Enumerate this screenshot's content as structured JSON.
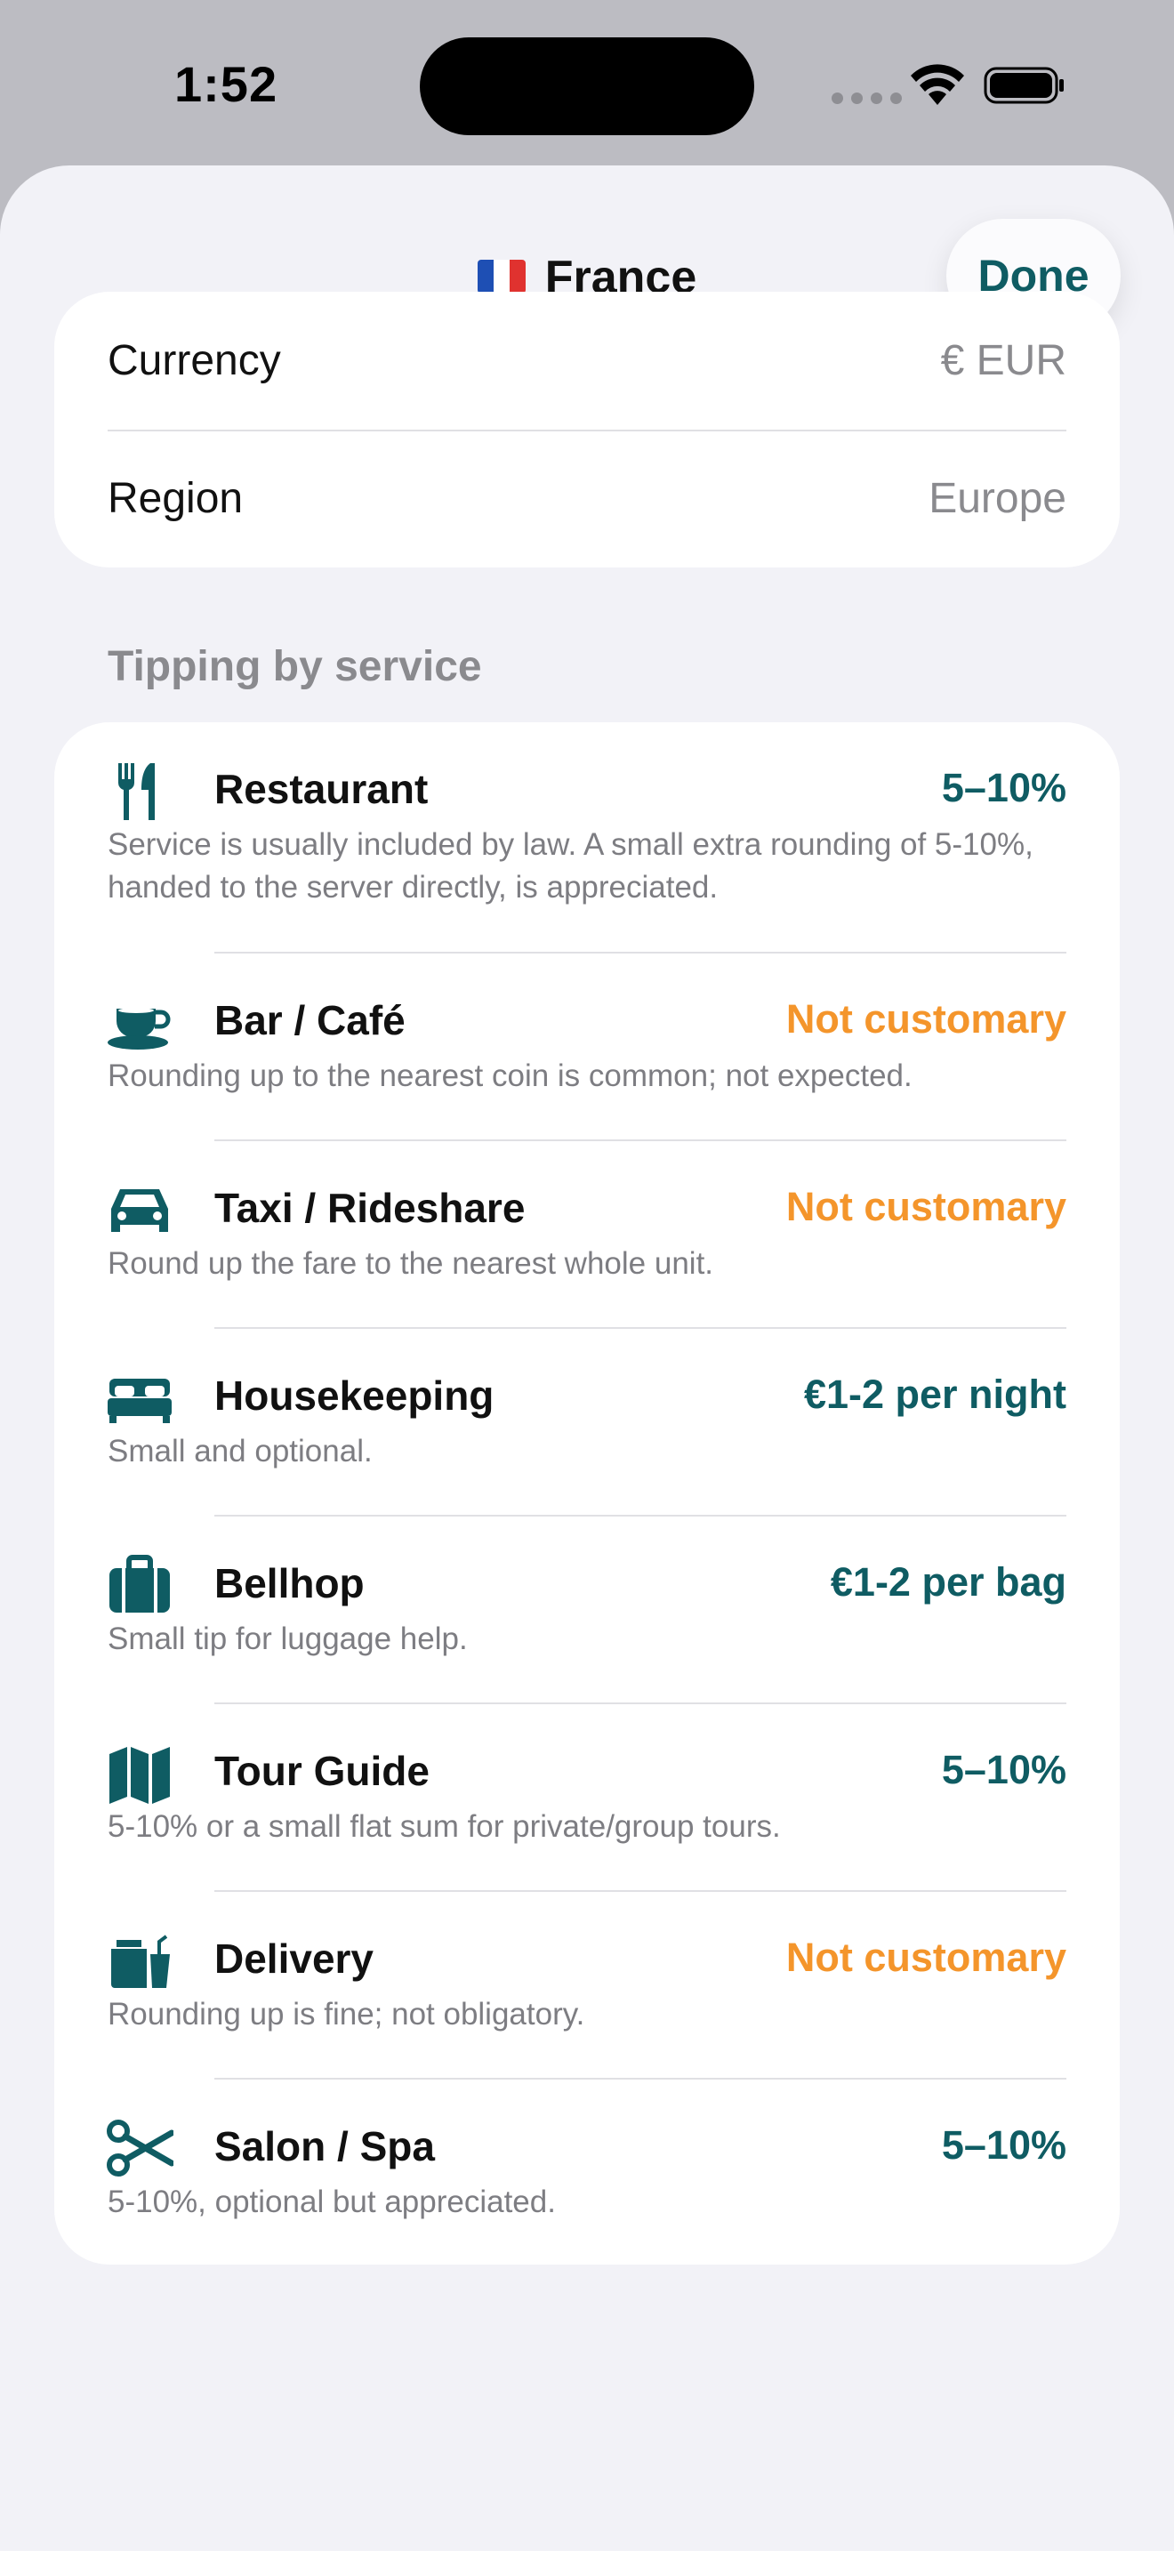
{
  "status_bar": {
    "time": "1:52"
  },
  "header": {
    "title": "France",
    "done_label": "Done"
  },
  "info": {
    "rows": [
      {
        "label": "Currency",
        "value": "€ EUR"
      },
      {
        "label": "Region",
        "value": "Europe"
      }
    ]
  },
  "section": {
    "title": "Tipping by service"
  },
  "colors": {
    "accent": "#0f5c63",
    "warning": "#f4952b",
    "secondary_text": "#8a8a8e",
    "background": "#f2f2f7"
  },
  "services": [
    {
      "icon": "fork-knife-icon",
      "name": "Restaurant",
      "value": "5–10%",
      "tone": "teal",
      "desc": "Service is usually included by law. A small extra rounding of 5-10%, handed to the server directly, is appreciated."
    },
    {
      "icon": "cup-icon",
      "name": "Bar / Café",
      "value": "Not customary",
      "tone": "orange",
      "desc": "Rounding up to the nearest coin is common; not expected."
    },
    {
      "icon": "car-icon",
      "name": "Taxi / Rideshare",
      "value": "Not customary",
      "tone": "orange",
      "desc": "Round up the fare to the nearest whole unit."
    },
    {
      "icon": "bed-icon",
      "name": "Housekeeping",
      "value": "€1-2 per night",
      "tone": "teal",
      "desc": "Small and optional."
    },
    {
      "icon": "suitcase-icon",
      "name": "Bellhop",
      "value": "€1-2 per bag",
      "tone": "teal",
      "desc": "Small tip for luggage help."
    },
    {
      "icon": "map-icon",
      "name": "Tour Guide",
      "value": "5–10%",
      "tone": "teal",
      "desc": "5-10% or a small flat sum for private/group tours."
    },
    {
      "icon": "bag-icon",
      "name": "Delivery",
      "value": "Not customary",
      "tone": "orange",
      "desc": "Rounding up is fine; not obligatory."
    },
    {
      "icon": "scissors-icon",
      "name": "Salon / Spa",
      "value": "5–10%",
      "tone": "teal",
      "desc": "5-10%, optional but appreciated."
    }
  ]
}
